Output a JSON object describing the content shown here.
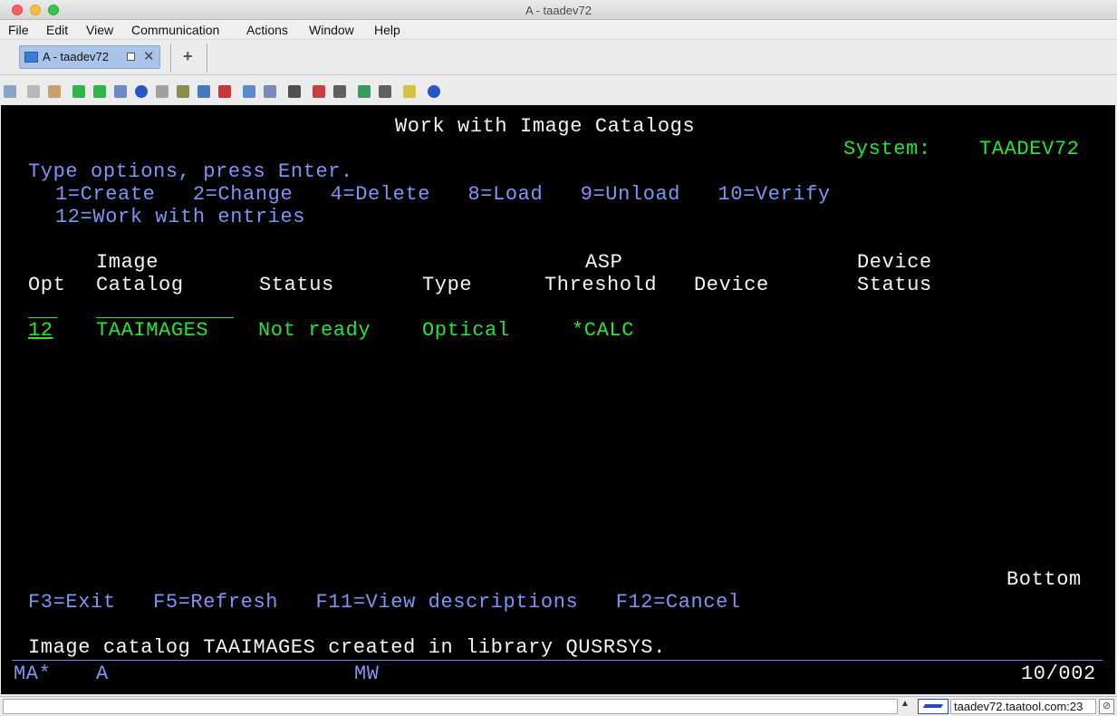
{
  "window": {
    "title": "A - taadev72"
  },
  "menu": [
    "File",
    "Edit",
    "View",
    "Communication",
    "Actions",
    "Window",
    "Help"
  ],
  "tabs": [
    {
      "label": "A - taadev72"
    }
  ],
  "screen": {
    "title": "Work with Image Catalogs",
    "system_label": "System:",
    "system_value": "TAADEV72",
    "instructions": "Type options, press Enter.",
    "options_line1": "1=Create   2=Change   4=Delete   8=Load   9=Unload   10=Verify",
    "options_line2": "12=Work with entries",
    "headers": {
      "opt": "Opt",
      "image_catalog_1": "Image",
      "image_catalog_2": "Catalog",
      "status": "Status",
      "type": "Type",
      "asp_1": "ASP",
      "asp_2": "Threshold",
      "device": "Device",
      "device_status_1": "Device",
      "device_status_2": "Status"
    },
    "rows": [
      {
        "opt": "12",
        "catalog": "TAAIMAGES",
        "status": "Not ready",
        "type": "Optical",
        "asp_threshold": "*CALC",
        "device": "",
        "device_status": ""
      }
    ],
    "bottom_indicator": "Bottom",
    "function_keys": "F3=Exit   F5=Refresh   F11=View descriptions   F12=Cancel",
    "message": "Image catalog TAAIMAGES created in library QUSRSYS.",
    "status_left": "MA*",
    "status_session": "A",
    "status_mode": "MW",
    "status_cursor": "10/002"
  },
  "statusbar": {
    "host": "taadev72.taatool.com:23"
  },
  "colors": {
    "screen_bg": "#000000",
    "green": "#22e43a",
    "blue": "#8094f2",
    "white": "#f4f4f4"
  }
}
